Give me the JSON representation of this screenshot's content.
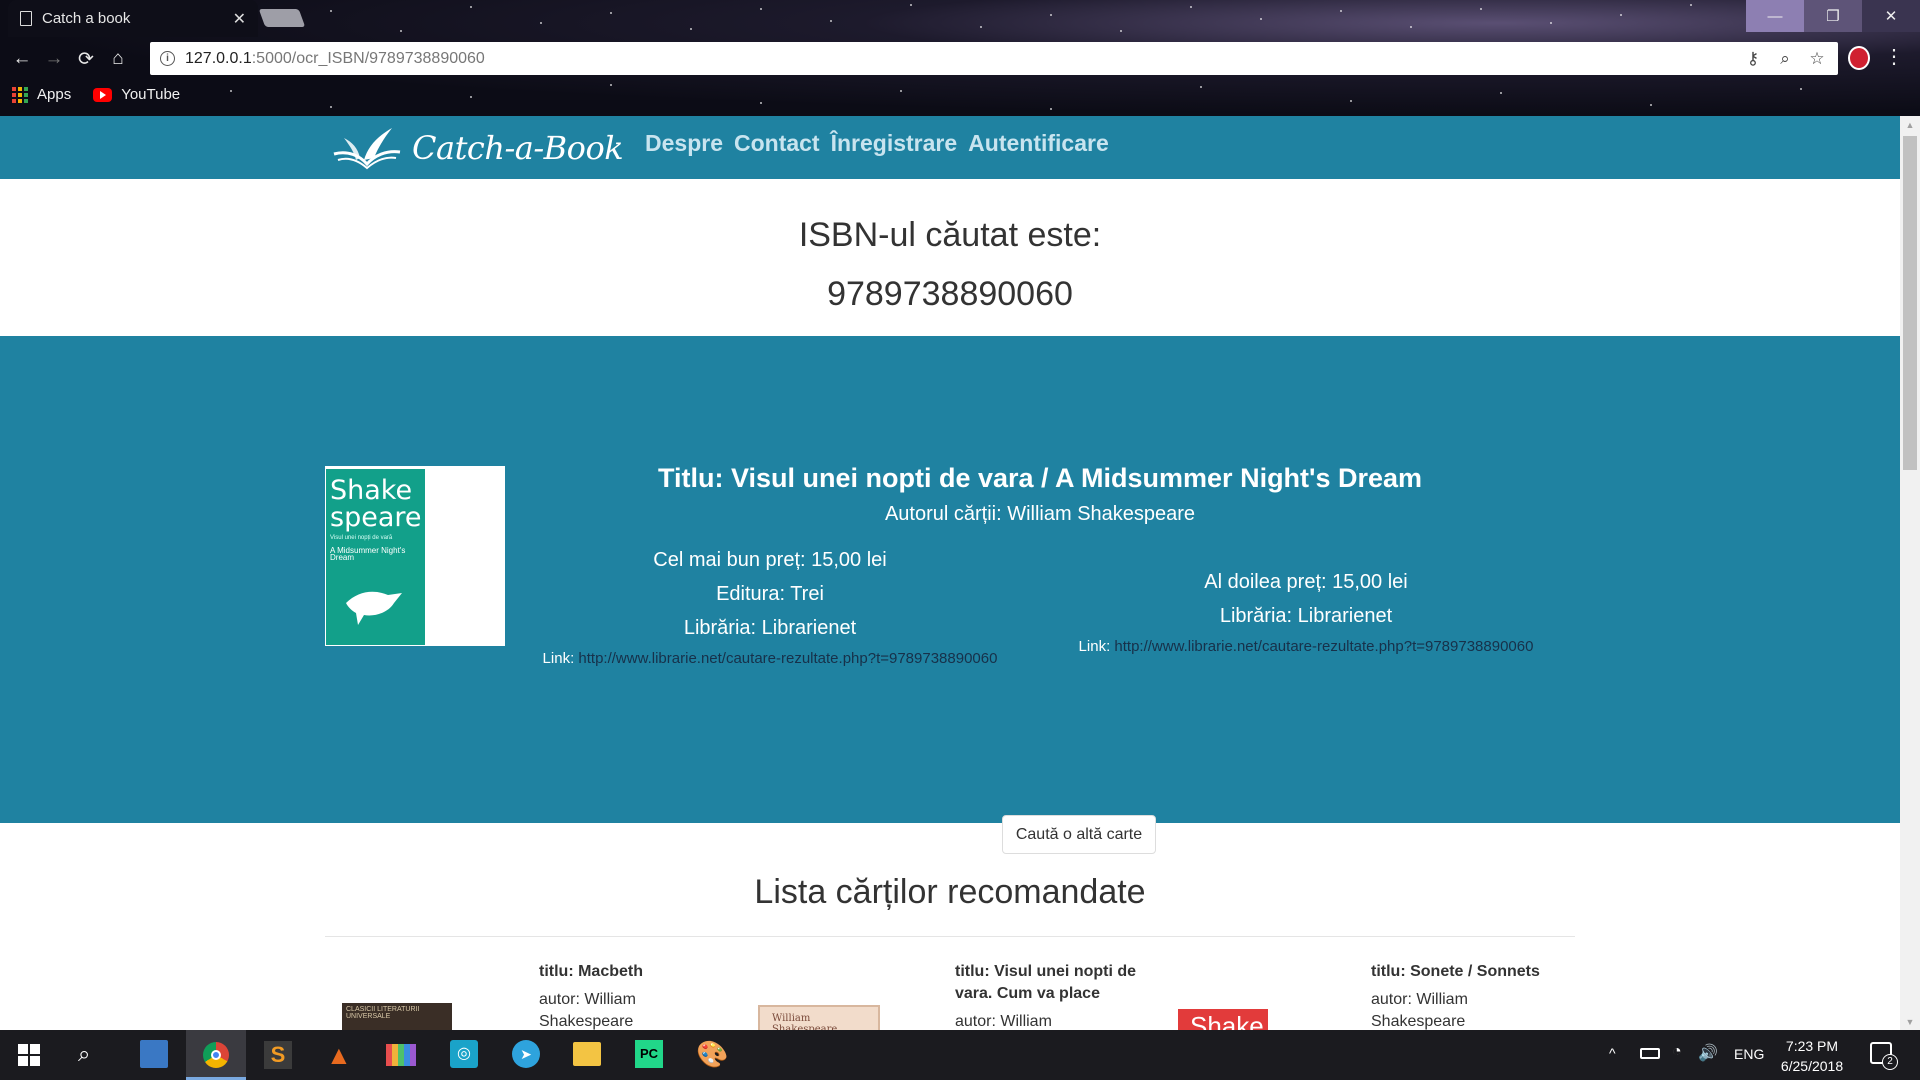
{
  "browser": {
    "tab_title": "Catch a book",
    "url_host": "127.0.0.1",
    "url_rest": ":5000/ocr_ISBN/9789738890060",
    "bookmarks": [
      {
        "label": "Apps",
        "icon": "apps-grid-icon"
      },
      {
        "label": "YouTube",
        "icon": "youtube-icon"
      }
    ]
  },
  "site": {
    "logo_text": "Catch-a-Book",
    "nav": [
      "Despre",
      "Contact",
      "Înregistrare",
      "Autentificare"
    ],
    "brand_color": "#1f82a1"
  },
  "isbn": {
    "label": "ISBN-ul căutat este:",
    "value": "9789738890060"
  },
  "book": {
    "cover": {
      "author_line1": "Shake",
      "author_line2": "speare",
      "romanian_title": "Visul unei nopți de vară",
      "english_title": "A Midsummer Night's Dream"
    },
    "title": "Titlu: Visul unei nopti de vara / A Midsummer Night's Dream",
    "author": "Autorul cărții: William Shakespeare",
    "best_offer": {
      "price": "Cel mai bun preț: 15,00 lei",
      "publisher": "Editura: Trei",
      "bookstore": "Librăria: Librarienet",
      "link_label": "Link:",
      "link_url": "http://www.librarie.net/cautare-rezultate.php?t=9789738890060"
    },
    "second_offer": {
      "price": "Al doilea preț: 15,00 lei",
      "bookstore": "Librăria: Librarienet",
      "link_label": "Link:",
      "link_url": "http://www.librarie.net/cautare-rezultate.php?t=9789738890060"
    },
    "search_again": "Caută o altă carte"
  },
  "recommended": {
    "heading": "Lista cărților recomandate",
    "items": [
      {
        "title": "titlu: Macbeth",
        "author": "autor: William Shakespeare",
        "thumb_text": "CLASICII LITERATURII UNIVERSALE"
      },
      {
        "title": "titlu: Visul unei nopti de vara. Cum va place",
        "author": "autor: William",
        "thumb_text": "William Shakespeare"
      },
      {
        "title": "titlu: Sonete / Sonnets",
        "author": "autor: William Shakespeare",
        "thumb_text": "Shake"
      }
    ]
  },
  "taskbar": {
    "language": "ENG",
    "time": "7:23 PM",
    "date": "6/25/2018",
    "notification_count": "2"
  }
}
